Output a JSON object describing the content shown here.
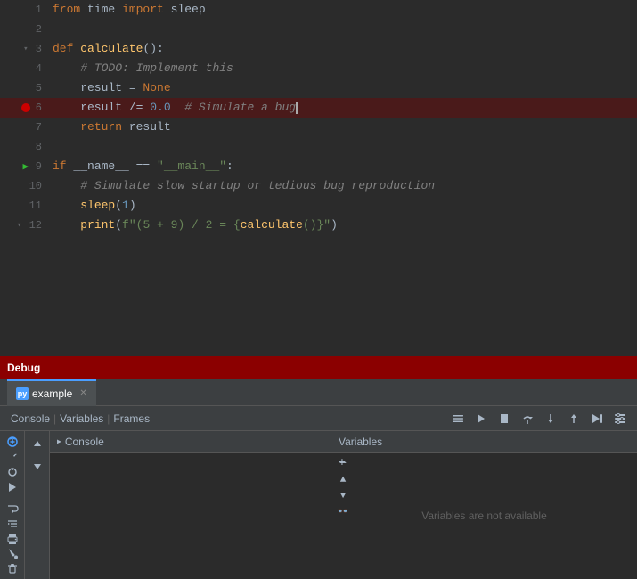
{
  "editor": {
    "lines": [
      {
        "num": 1,
        "gutter": "",
        "content_html": "<span class='kw'>from</span> time <span class='kw'>import</span> sleep",
        "highlighted": false
      },
      {
        "num": 2,
        "gutter": "",
        "content_html": "",
        "highlighted": false
      },
      {
        "num": 3,
        "gutter": "fold",
        "content_html": "<span class='kw'>def</span> <span class='fn'>calculate</span>():",
        "highlighted": false
      },
      {
        "num": 4,
        "gutter": "",
        "content_html": "    <span class='cm'># TODO: Implement <span class='cm-this'>this</span></span>",
        "highlighted": false
      },
      {
        "num": 5,
        "gutter": "",
        "content_html": "    result = <span class='none-kw'>None</span>",
        "highlighted": false
      },
      {
        "num": 6,
        "gutter": "breakpoint",
        "content_html": "    result /= <span class='nm'>0.0</span>  <span class='cm'># Simulate a bug</span>",
        "highlighted": true,
        "cursor": true
      },
      {
        "num": 7,
        "gutter": "",
        "content_html": "    <span class='kw'>return</span> result",
        "highlighted": false
      },
      {
        "num": 8,
        "gutter": "",
        "content_html": "",
        "highlighted": false
      },
      {
        "num": 9,
        "gutter": "debug-fold",
        "content_html": "<span class='kw'>if</span> __name__ == <span class='st'>\"__main__\"</span>:",
        "highlighted": false
      },
      {
        "num": 10,
        "gutter": "",
        "content_html": "    <span class='cm'># Simulate slow startup or tedious bug reproduction</span>",
        "highlighted": false
      },
      {
        "num": 11,
        "gutter": "",
        "content_html": "    <span class='fn'>sleep</span>(<span class='nm'>1</span>)",
        "highlighted": false
      },
      {
        "num": 12,
        "gutter": "fold",
        "content_html": "    <span class='fn'>print</span>(<span class='fstring'>f\"(5 + 9) / 2 = {<span class='fn'>calculate</span>()}\"</span>)",
        "highlighted": false
      }
    ]
  },
  "debug_bar": {
    "label": "Debug"
  },
  "debug_panel": {
    "tab_label": "example",
    "tab_icon": "py",
    "toolbar_links": [
      "Console",
      "Variables",
      "Frames"
    ],
    "toolbar_buttons": [
      "menu",
      "resume",
      "stop",
      "step-over",
      "step-into",
      "step-out",
      "run-to-cursor",
      "settings"
    ],
    "console_label": "Console",
    "variables_label": "Variables",
    "variables_empty": "Variables are not available",
    "left_icons": [
      "bug",
      "wrench",
      "bug2",
      "play",
      "empty",
      "wrap",
      "indent",
      "print",
      "paint",
      "trash"
    ],
    "step_buttons": [
      "up",
      "down"
    ]
  }
}
